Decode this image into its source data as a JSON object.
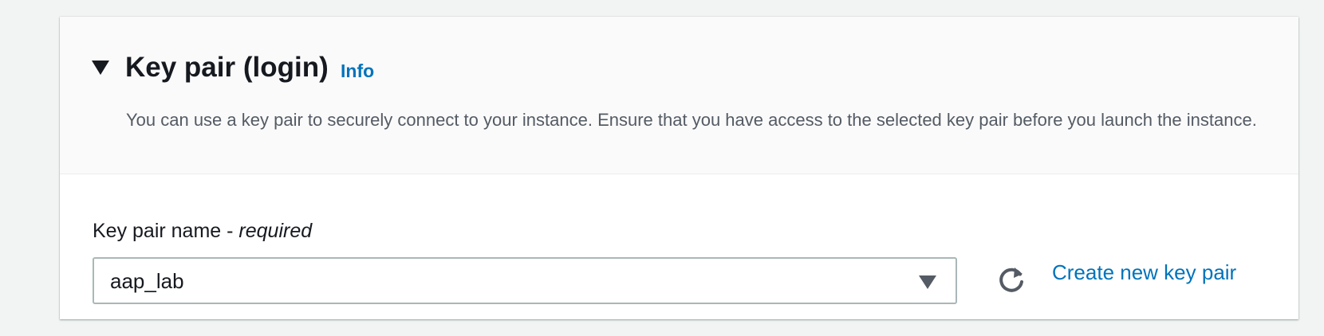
{
  "section": {
    "title": "Key pair (login)",
    "info_label": "Info",
    "description": "You can use a key pair to securely connect to your instance. Ensure that you have access to the selected key pair before you launch the instance."
  },
  "key_pair_field": {
    "label": "Key pair name - ",
    "label_required": "required",
    "selected_value": "aap_lab"
  },
  "actions": {
    "refresh_icon": "refresh-icon",
    "create_link": "Create new key pair"
  },
  "colors": {
    "link": "#0073bb",
    "text": "#16191f",
    "muted_text": "#545b64",
    "page_bg": "#f2f3f3"
  }
}
